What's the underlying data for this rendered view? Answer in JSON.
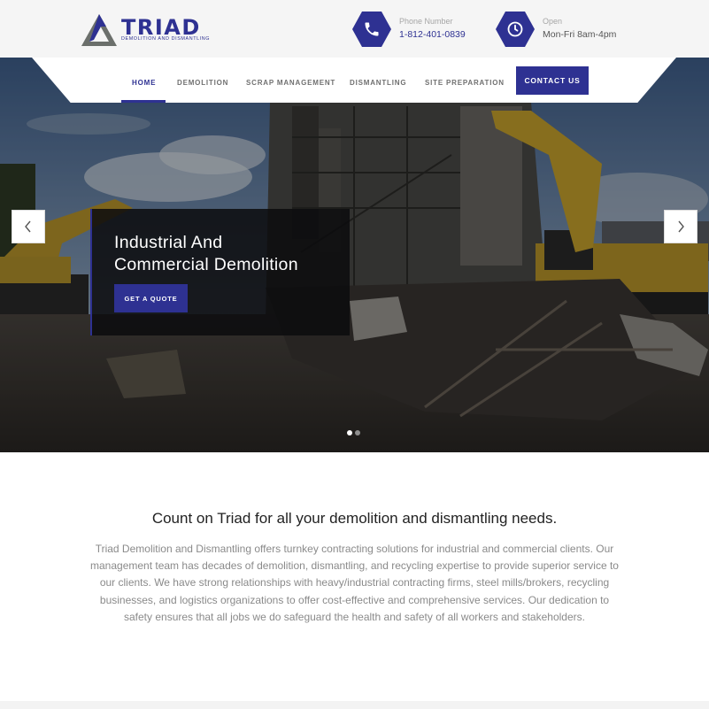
{
  "brand": {
    "name": "TRIAD",
    "tagline": "DEMOLITION AND DISMANTLING",
    "colors": {
      "primary": "#2e3192",
      "logo_gray": "#6b6f6b"
    }
  },
  "header": {
    "phone": {
      "icon": "phone-icon",
      "label": "Phone Number",
      "value": "1-812-401-0839"
    },
    "hours": {
      "icon": "clock-icon",
      "label": "Open",
      "value": "Mon-Fri 8am-4pm"
    }
  },
  "nav": {
    "items": [
      {
        "label": "HOME",
        "active": true
      },
      {
        "label": "DEMOLITION",
        "active": false
      },
      {
        "label": "SCRAP MANAGEMENT",
        "active": false
      },
      {
        "label": "DISMANTLING",
        "active": false
      },
      {
        "label": "SITE PREPARATION",
        "active": false
      }
    ],
    "cta": "CONTACT US"
  },
  "hero": {
    "title_line1": "Industrial And",
    "title_line2": "Commercial Demolition",
    "button": "GET A QUOTE",
    "prev_icon": "chevron-left-icon",
    "next_icon": "chevron-right-icon",
    "slide_count": 2,
    "active_slide": 1
  },
  "intro": {
    "heading": "Count on Triad for all your demolition and dismantling needs.",
    "body": "Triad Demolition and Dismantling offers turnkey contracting solutions for industrial and commercial clients. Our management team has decades of demolition, dismantling, and recycling expertise to provide superior service to our clients. We have strong relationships with heavy/industrial contracting firms, steel mills/brokers, recycling businesses, and logistics organizations to offer cost-effective and comprehensive services. Our dedication to safety ensures that all jobs we do safeguard the health and safety of all workers and stakeholders."
  }
}
